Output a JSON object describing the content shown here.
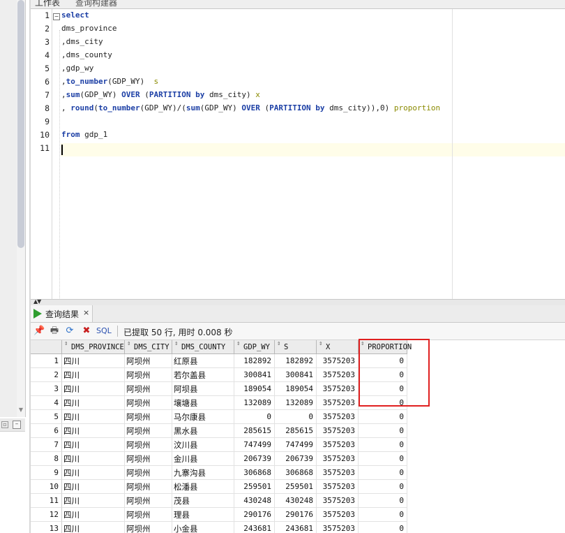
{
  "tabs": [
    "工作表",
    "查询构建器"
  ],
  "editor": {
    "line_numbers": [
      "1",
      "2",
      "3",
      "4",
      "5",
      "6",
      "7",
      "8",
      "9",
      "10",
      "11"
    ],
    "lines": [
      [
        {
          "t": "select",
          "c": "kw"
        }
      ],
      [
        {
          "t": "dms_province",
          "c": ""
        }
      ],
      [
        {
          "t": ",dms_city",
          "c": ""
        }
      ],
      [
        {
          "t": ",dms_county",
          "c": ""
        }
      ],
      [
        {
          "t": ",gdp_wy",
          "c": ""
        }
      ],
      [
        {
          "t": ",",
          "c": ""
        },
        {
          "t": "to_number",
          "c": "fn"
        },
        {
          "t": "(GDP_WY)  ",
          "c": ""
        },
        {
          "t": "s",
          "c": "al"
        }
      ],
      [
        {
          "t": ",",
          "c": ""
        },
        {
          "t": "sum",
          "c": "fn"
        },
        {
          "t": "(GDP_WY) ",
          "c": ""
        },
        {
          "t": "OVER",
          "c": "kw"
        },
        {
          "t": " (",
          "c": ""
        },
        {
          "t": "PARTITION by",
          "c": "kw"
        },
        {
          "t": " dms_city) ",
          "c": ""
        },
        {
          "t": "x",
          "c": "al"
        }
      ],
      [
        {
          "t": ", ",
          "c": ""
        },
        {
          "t": "round",
          "c": "fn"
        },
        {
          "t": "(",
          "c": ""
        },
        {
          "t": "to_number",
          "c": "fn"
        },
        {
          "t": "(GDP_WY)/(",
          "c": ""
        },
        {
          "t": "sum",
          "c": "fn"
        },
        {
          "t": "(GDP_WY) ",
          "c": ""
        },
        {
          "t": "OVER",
          "c": "kw"
        },
        {
          "t": " (",
          "c": ""
        },
        {
          "t": "PARTITION by",
          "c": "kw"
        },
        {
          "t": " dms_city)),0) ",
          "c": ""
        },
        {
          "t": "proportion",
          "c": "al"
        }
      ],
      [],
      [
        {
          "t": "from",
          "c": "kw"
        },
        {
          "t": " gdp_1",
          "c": ""
        }
      ],
      []
    ]
  },
  "results": {
    "tab_label": "查询结果",
    "tab_close": "×",
    "toolbar": {
      "sql_label": "SQL",
      "status": "已提取 50 行, 用时 0.008 秒"
    },
    "columns": [
      "DMS_PROVINCE",
      "DMS_CITY",
      "DMS_COUNTY",
      "GDP_WY",
      "S",
      "X",
      "PROPORTION"
    ],
    "rows": [
      [
        "1",
        "四川",
        "阿坝州",
        "红原县",
        "182892",
        "182892",
        "3575203",
        "0"
      ],
      [
        "2",
        "四川",
        "阿坝州",
        "若尔盖县",
        "300841",
        "300841",
        "3575203",
        "0"
      ],
      [
        "3",
        "四川",
        "阿坝州",
        "阿坝县",
        "189054",
        "189054",
        "3575203",
        "0"
      ],
      [
        "4",
        "四川",
        "阿坝州",
        "壤塘县",
        "132089",
        "132089",
        "3575203",
        "0"
      ],
      [
        "5",
        "四川",
        "阿坝州",
        "马尔康县",
        "0",
        "0",
        "3575203",
        "0"
      ],
      [
        "6",
        "四川",
        "阿坝州",
        "黑水县",
        "285615",
        "285615",
        "3575203",
        "0"
      ],
      [
        "7",
        "四川",
        "阿坝州",
        "汶川县",
        "747499",
        "747499",
        "3575203",
        "0"
      ],
      [
        "8",
        "四川",
        "阿坝州",
        "金川县",
        "206739",
        "206739",
        "3575203",
        "0"
      ],
      [
        "9",
        "四川",
        "阿坝州",
        "九寨沟县",
        "306868",
        "306868",
        "3575203",
        "0"
      ],
      [
        "10",
        "四川",
        "阿坝州",
        "松潘县",
        "259501",
        "259501",
        "3575203",
        "0"
      ],
      [
        "11",
        "四川",
        "阿坝州",
        "茂县",
        "430248",
        "430248",
        "3575203",
        "0"
      ],
      [
        "12",
        "四川",
        "阿坝州",
        "理县",
        "290176",
        "290176",
        "3575203",
        "0"
      ],
      [
        "13",
        "四川",
        "阿坝州",
        "小金县",
        "243681",
        "243681",
        "3575203",
        "0"
      ]
    ]
  },
  "colors": {
    "keyword": "#1c3fa5",
    "alias": "#8a8a00",
    "highlight_box": "#e02020",
    "run_icon": "#2f9e2f"
  }
}
